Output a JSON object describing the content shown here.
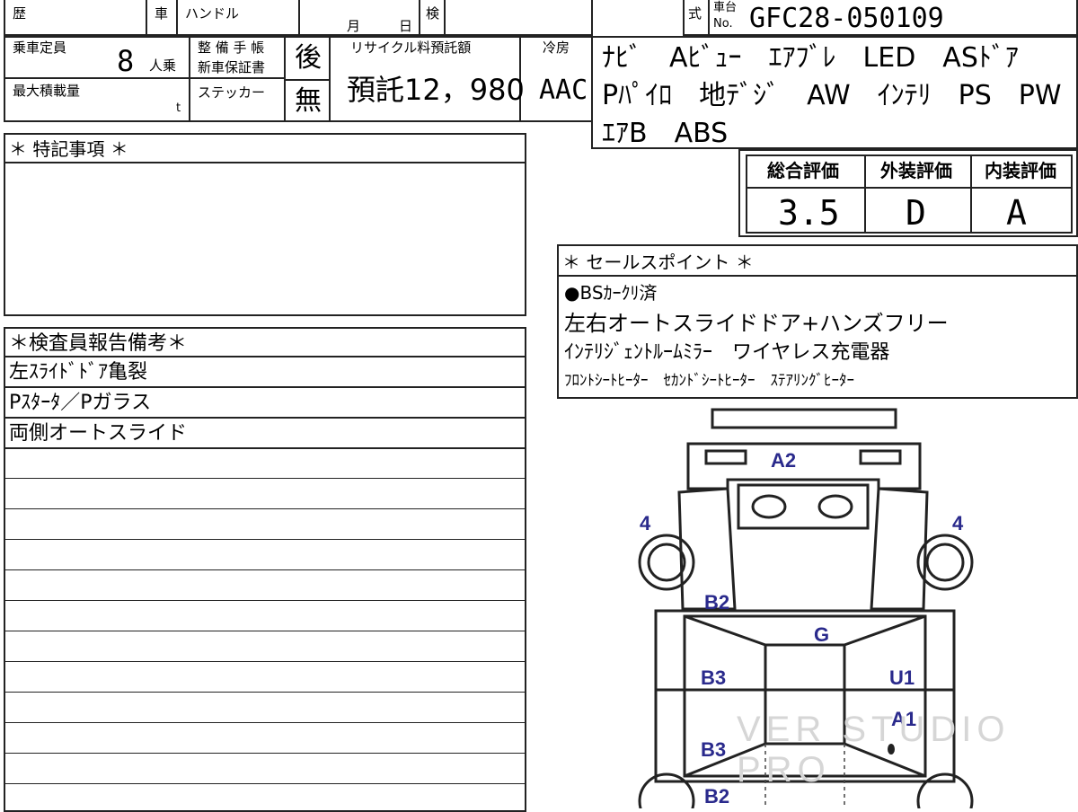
{
  "header": {
    "history_label": "歴",
    "car_label": "車",
    "handle_label": "ハンドル",
    "month_label": "月",
    "day_label": "日",
    "inspection_label": "検",
    "type_label": "式",
    "chassis_label_top": "車台",
    "chassis_label_no": "No.",
    "chassis_number": "GFC28-050109"
  },
  "specs": {
    "capacity_label": "乗車定員",
    "capacity_value": "8",
    "capacity_unit": "人乗",
    "max_load_label": "最大積載量",
    "max_load_unit": "t",
    "maintenance_label_1": "整 備 手 帳",
    "maintenance_label_2": "新車保証書",
    "maintenance_value": "後",
    "sticker_label": "ステッカー",
    "sticker_value": "無",
    "recycle_label": "リサイクル料預託額",
    "recycle_value": "預託12，980",
    "ac_label": "冷房",
    "ac_value": "AAC"
  },
  "equipment": {
    "line1": "ﾅﾋﾞ　Aﾋﾞｭｰ　ｴｱﾌﾞﾚ　LED　ASﾄﾞｱ",
    "line2": "Pﾊﾟｲﾛ　地ﾃﾞｼﾞ　AW　ｲﾝﾃﾘ　PS　PW",
    "line3": "ｴｱB　ABS"
  },
  "ratings": {
    "overall_label": "総合評価",
    "overall_value": "3.5",
    "exterior_label": "外装評価",
    "exterior_value": "D",
    "interior_label": "内装評価",
    "interior_value": "A"
  },
  "special_notes": {
    "title": "＊ 特記事項 ＊"
  },
  "sales_points": {
    "title": "＊ セールスポイント ＊",
    "items": [
      "●BSｶｰｸﾘ済",
      "左右オートスライドドア+ハンズフリー",
      "ｲﾝﾃﾘｼﾞｪﾝﾄﾙｰﾑﾐﾗｰ　ワイヤレス充電器",
      "ﾌﾛﾝﾄｼｰﾄﾋｰﾀｰ　ｾｶﾝﾄﾞｼｰﾄﾋｰﾀｰ　ｽﾃｱﾘﾝｸﾞﾋｰﾀｰ"
    ]
  },
  "inspector": {
    "title": "＊検査員報告備考＊",
    "lines": [
      "左ｽﾗｲﾄﾞﾄﾞｱ亀裂",
      "Pｽﾀｰﾀ／Pガラス",
      "両側オートスライド"
    ]
  },
  "diagram": {
    "marks": {
      "a2": "A2",
      "four_left": "4",
      "four_right": "4",
      "b2_top": "B2",
      "g": "G",
      "b3_upper": "B3",
      "u1": "U1",
      "a1": "A1",
      "b3_lower": "B3",
      "b2_bottom": "B2"
    },
    "mark_color": "#2a2a8c"
  },
  "watermark": "VER STUDIO PRO"
}
